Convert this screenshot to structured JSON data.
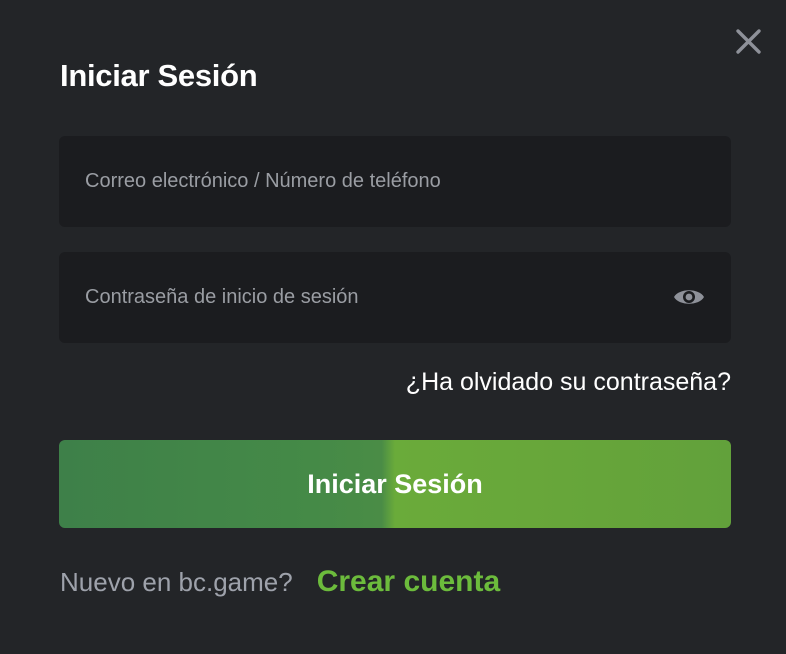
{
  "dialog": {
    "title": "Iniciar Sesión",
    "close_icon": "close-icon"
  },
  "form": {
    "email": {
      "placeholder": "Correo electrónico / Número de teléfono",
      "value": ""
    },
    "password": {
      "placeholder": "Contraseña de inicio de sesión",
      "value": "",
      "toggle_icon": "eye-icon"
    },
    "forgot_label": "¿Ha olvidado su contraseña?",
    "submit_label": "Iniciar Sesión"
  },
  "footer": {
    "prompt": "Nuevo en bc.game?",
    "signup_label": "Crear cuenta"
  },
  "colors": {
    "background": "#232528",
    "field_background": "#1b1c1f",
    "accent_green": "#6cbb3c",
    "button_green": "#62a13b"
  }
}
